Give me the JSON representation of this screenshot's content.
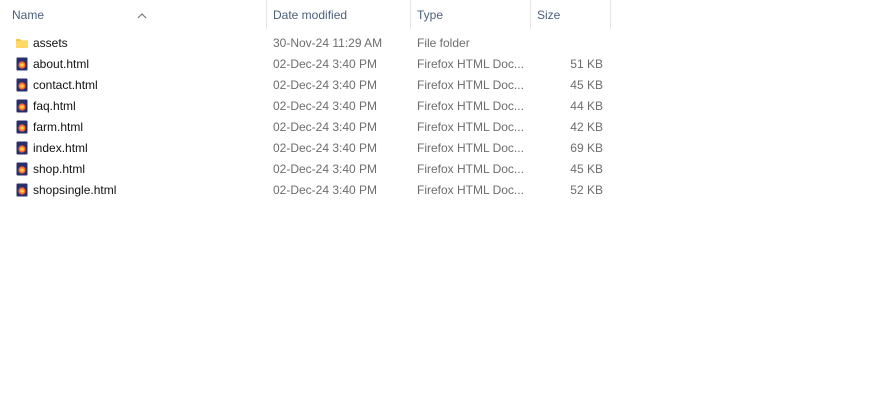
{
  "columns": {
    "name": "Name",
    "date_modified": "Date modified",
    "type": "Type",
    "size": "Size"
  },
  "sort": {
    "column": "name",
    "direction": "ascending"
  },
  "colors": {
    "folder": "#f3c842",
    "html_icon_bg": "#2a2f6b",
    "html_icon_flame": "#ff6a2b"
  },
  "files": [
    {
      "name": "assets",
      "date": "30-Nov-24 11:29 AM",
      "type": "File folder",
      "size": "",
      "icon": "folder-icon"
    },
    {
      "name": "about.html",
      "date": "02-Dec-24 3:40 PM",
      "type": "Firefox HTML Doc...",
      "size": "51 KB",
      "icon": "firefox-html-icon"
    },
    {
      "name": "contact.html",
      "date": "02-Dec-24 3:40 PM",
      "type": "Firefox HTML Doc...",
      "size": "45 KB",
      "icon": "firefox-html-icon"
    },
    {
      "name": "faq.html",
      "date": "02-Dec-24 3:40 PM",
      "type": "Firefox HTML Doc...",
      "size": "44 KB",
      "icon": "firefox-html-icon"
    },
    {
      "name": "farm.html",
      "date": "02-Dec-24 3:40 PM",
      "type": "Firefox HTML Doc...",
      "size": "42 KB",
      "icon": "firefox-html-icon"
    },
    {
      "name": "index.html",
      "date": "02-Dec-24 3:40 PM",
      "type": "Firefox HTML Doc...",
      "size": "69 KB",
      "icon": "firefox-html-icon"
    },
    {
      "name": "shop.html",
      "date": "02-Dec-24 3:40 PM",
      "type": "Firefox HTML Doc...",
      "size": "45 KB",
      "icon": "firefox-html-icon"
    },
    {
      "name": "shopsingle.html",
      "date": "02-Dec-24 3:40 PM",
      "type": "Firefox HTML Doc...",
      "size": "52 KB",
      "icon": "firefox-html-icon"
    }
  ]
}
